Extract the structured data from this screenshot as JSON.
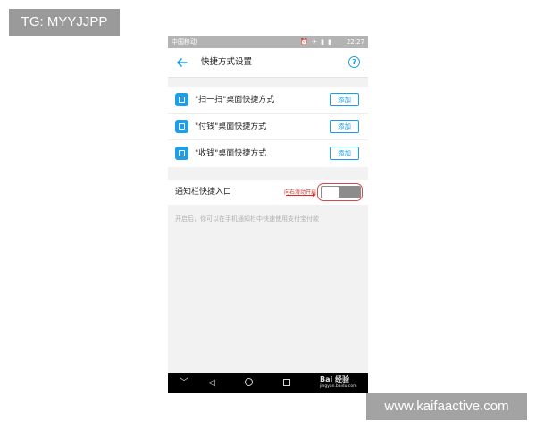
{
  "overlay": {
    "top_left_tag": "TG: MYYJJPP",
    "bottom_right_tag": "www.kaifaactive.com"
  },
  "status_bar": {
    "carrier": "中国移动",
    "icons": "⏰ ✈ ▮ ▮",
    "time": "22:27"
  },
  "header": {
    "back_icon": "arrow-left-icon",
    "title": "快捷方式设置",
    "help_icon": "question-circle-icon"
  },
  "shortcuts": [
    {
      "label": "\"扫一扫\"桌面快捷方式",
      "button": "添加",
      "icon": "scan-icon"
    },
    {
      "label": "\"付钱\"桌面快捷方式",
      "button": "添加",
      "icon": "pay-icon"
    },
    {
      "label": "\"收钱\"桌面快捷方式",
      "button": "添加",
      "icon": "receive-icon"
    }
  ],
  "notification": {
    "label": "通知栏快捷入口",
    "annotation": "向右滑动开启",
    "toggle_on": false,
    "hint": "开启后，你可以在手机通知栏中快速使用支付宝付款"
  },
  "nav_bar": {
    "down": "﹀",
    "back": "◁",
    "watermark_brand": "Bai 经验",
    "watermark_site": "jingyan.baidu.com"
  },
  "colors": {
    "accent": "#1aa0e8",
    "annotation": "#d32a2a",
    "toggle_off": "#8c8c8c"
  }
}
